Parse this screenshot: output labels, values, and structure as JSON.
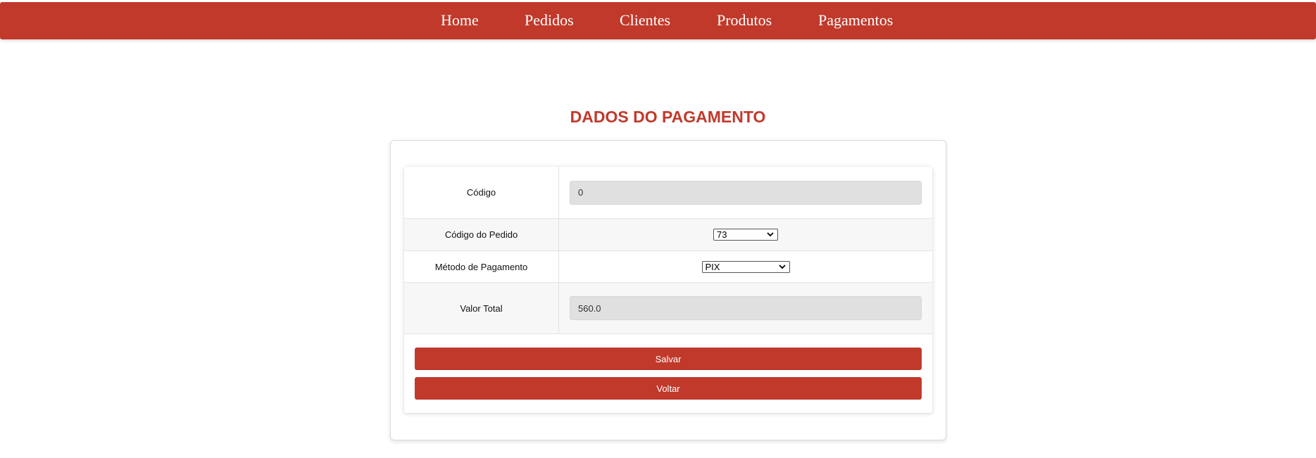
{
  "nav": {
    "items": [
      {
        "label": "Home"
      },
      {
        "label": "Pedidos"
      },
      {
        "label": "Clientes"
      },
      {
        "label": "Produtos"
      },
      {
        "label": "Pagamentos"
      }
    ]
  },
  "page": {
    "title": "DADOS DO PAGAMENTO"
  },
  "form": {
    "codigo": {
      "label": "Código",
      "value": "0"
    },
    "pedido": {
      "label": "Código do Pedido",
      "selected": "73"
    },
    "metodo": {
      "label": "Método de Pagamento",
      "selected": "PIX"
    },
    "valor": {
      "label": "Valor Total",
      "value": "560.0"
    }
  },
  "buttons": {
    "salvar": "Salvar",
    "voltar": "Voltar"
  },
  "colors": {
    "brand": "#c0392b",
    "input_bg": "#e0e0e0"
  },
  "icons": {
    "select_chevron": "chevron-down-icon"
  }
}
